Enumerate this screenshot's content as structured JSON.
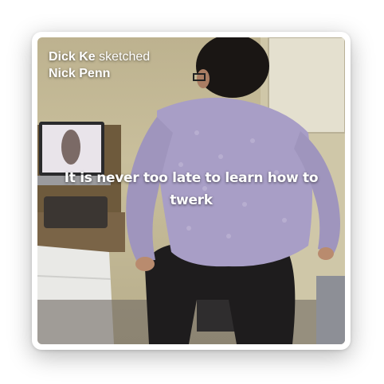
{
  "post": {
    "author": "Dick Ke",
    "action": "sketched",
    "subject": "Nick Penn",
    "message": "It is never too late to learn how to twerk"
  },
  "photo": {
    "description_icon": "photo-image"
  },
  "colors": {
    "wall": "#c2b894",
    "sweater": "#a99ec4",
    "pants": "#1d1b1c",
    "hair": "#1a1614",
    "text": "#ffffff"
  }
}
